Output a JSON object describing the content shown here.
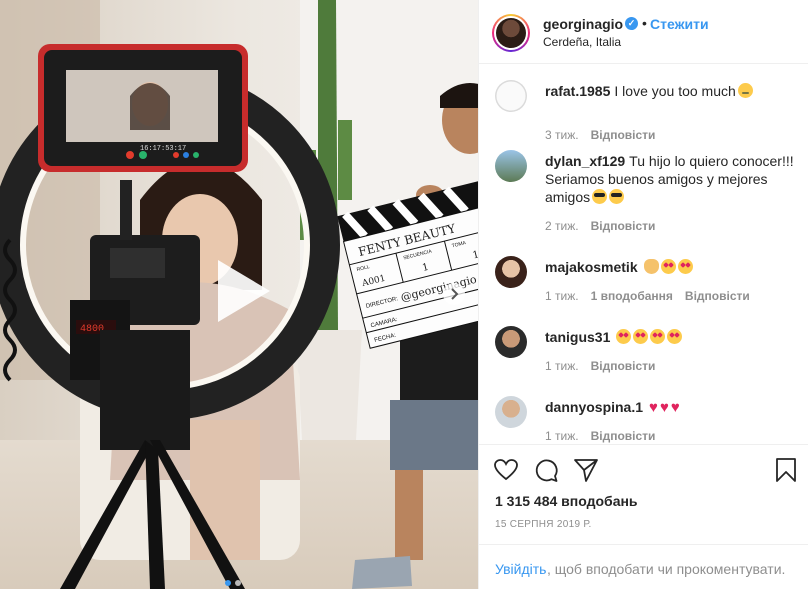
{
  "post": {
    "username": "georginagio",
    "verified_glyph": "✓",
    "separator": "•",
    "follow_label": "Стежити",
    "location": "Cerdeña, Italia"
  },
  "clapper": {
    "brand": "FENTY BEAUTY",
    "roll_header": "ROLL",
    "scene_header": "SECUENCIA",
    "take_header": "TOMA",
    "roll": "A001",
    "scene": "1",
    "take": "1",
    "director_label": "DIRECTOR:",
    "director_value": "@georginagio",
    "camera_label": "CAMARA:",
    "date_label": "FECHA:"
  },
  "monitor": {
    "timecode": "16:17:53:17",
    "display": "4800"
  },
  "comments": [
    {
      "user": "rafat.1985",
      "text": "I love you too much",
      "emoji": "sad",
      "time": "3 тиж.",
      "likes": "",
      "reply": "Відповісти"
    },
    {
      "user": "dylan_xf129",
      "text": "Tu hijo lo quiero conocer!!! Seriamos buenos amigos y mejores amigos",
      "emoji": "cool2",
      "time": "2 тиж.",
      "likes": "",
      "reply": "Відповісти"
    },
    {
      "user": "majakosmetik",
      "text": "",
      "emoji": "hand-heart2",
      "time": "1 тиж.",
      "likes": "1 вподобання",
      "reply": "Відповісти"
    },
    {
      "user": "tanigus31",
      "text": "",
      "emoji": "heart-eyes4",
      "time": "1 тиж.",
      "likes": "",
      "reply": "Відповісти"
    },
    {
      "user": "dannyospina.1",
      "text": "",
      "emoji": "hearts3",
      "heart_glyph": "♥",
      "time": "1 тиж.",
      "likes": "",
      "reply": "Відповісти"
    }
  ],
  "actions": {
    "like_icon": "heart-outline-icon",
    "comment_icon": "comment-icon",
    "share_icon": "share-icon",
    "save_icon": "bookmark-icon",
    "likes_total": "1 315 484 вподобань",
    "date": "15 СЕРПНЯ 2019 Р."
  },
  "add_comment": {
    "login_label": "Увійдіть",
    "prompt": ", щоб вподобати чи прокоментувати."
  },
  "colors": {
    "accent": "#3897f0",
    "muted": "#8e8e8e",
    "border": "#efefef"
  }
}
